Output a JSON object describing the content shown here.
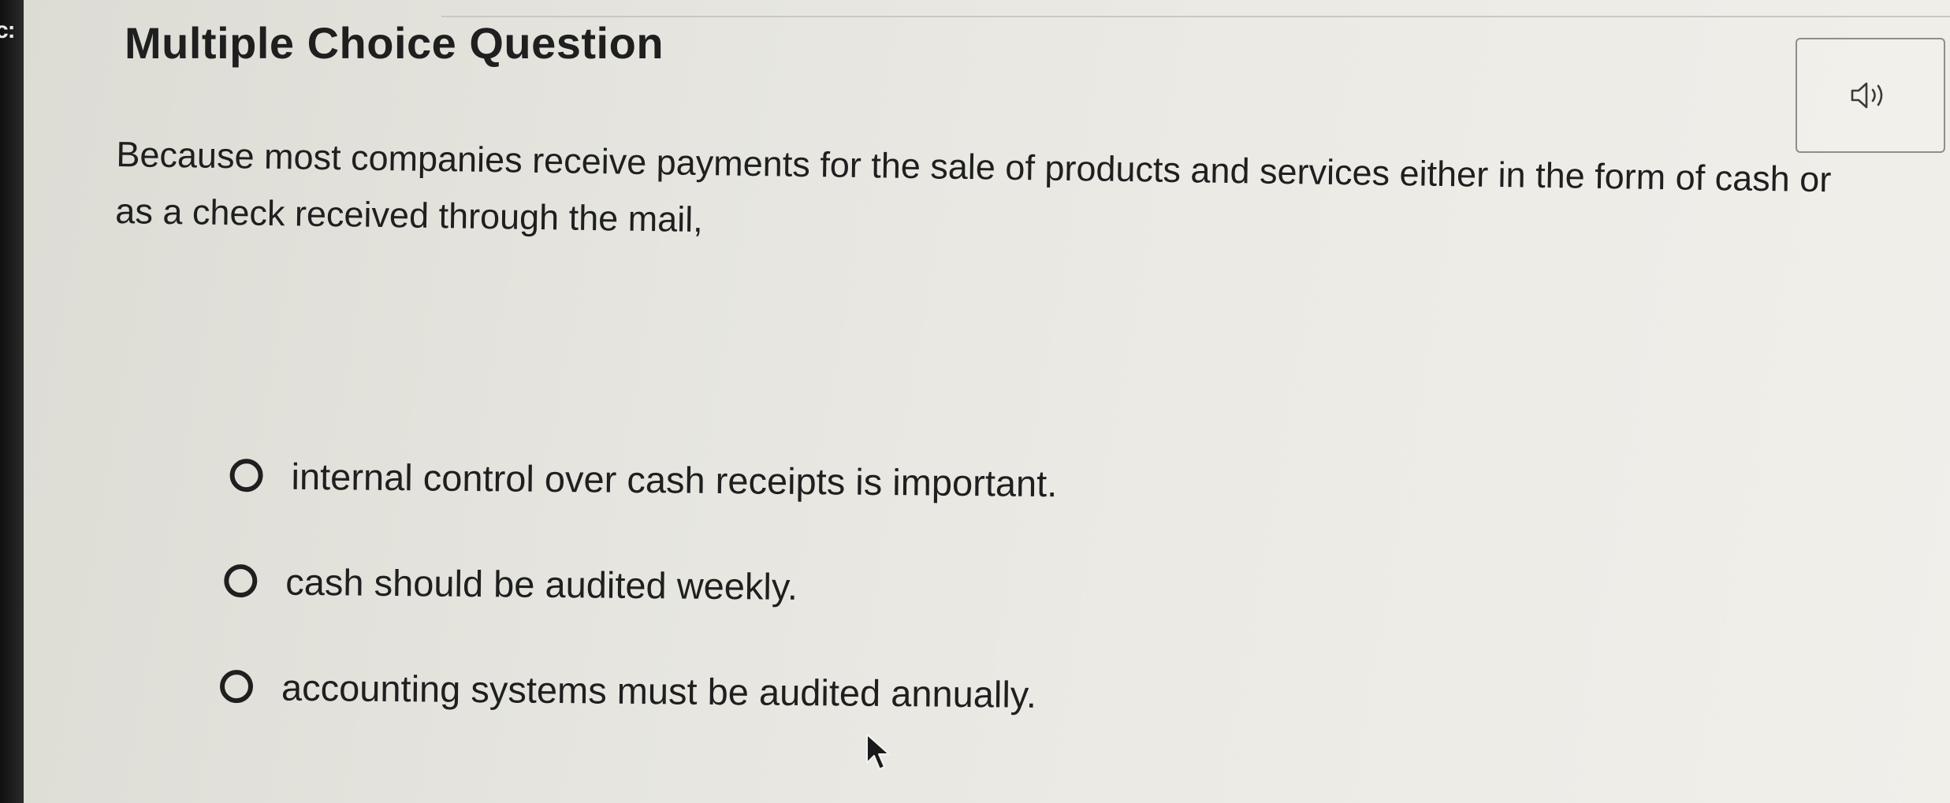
{
  "page": {
    "edge_label": "c:",
    "title": "Multiple Choice Question"
  },
  "audio": {
    "icon": "speaker-icon"
  },
  "question": {
    "text": "Because most companies receive payments for the sale of products and services either in the form of cash or as a check received through the mail,"
  },
  "options": [
    {
      "label": "internal control over cash receipts is important.",
      "selected": false
    },
    {
      "label": "cash should be audited weekly.",
      "selected": false
    },
    {
      "label": "accounting systems must be audited annually.",
      "selected": false
    }
  ],
  "cursor": {
    "icon": "mouse-pointer-icon"
  }
}
